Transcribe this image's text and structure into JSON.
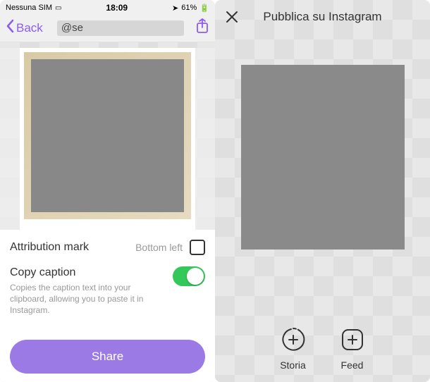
{
  "left": {
    "status": {
      "carrier": "Nessuna SIM",
      "time": "18:09",
      "battery": "61%"
    },
    "nav": {
      "back": "Back",
      "handle": "@se"
    },
    "attribution": {
      "label": "Attribution mark",
      "position": "Bottom left"
    },
    "copy": {
      "title": "Copy caption",
      "description": "Copies the caption text into your clipboard, allowing you to paste it in Instagram.",
      "enabled": true
    },
    "share_label": "Share"
  },
  "right": {
    "title": "Pubblica su Instagram",
    "options": {
      "storia": "Storia",
      "feed": "Feed"
    }
  }
}
